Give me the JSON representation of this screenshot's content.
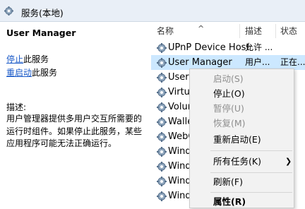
{
  "window": {
    "title": "服务(本地)"
  },
  "left_panel": {
    "service_name": "User Manager",
    "actions": [
      {
        "link": "停止",
        "rest": "此服务"
      },
      {
        "link": "重启动",
        "rest": "此服务"
      }
    ],
    "description_label": "描述:",
    "description": "用户管理器提供多用户交互所需要的运行时组件。如果停止此服务，某些应用程序可能无法正确运行。"
  },
  "list": {
    "columns": {
      "name": "名称",
      "description": "描述",
      "status": "状态"
    },
    "rows": [
      {
        "name": "UPnP Device Host",
        "desc": "允许 ...",
        "status": ""
      },
      {
        "name": "User Manager",
        "desc": "用户...",
        "status": "正在..."
      },
      {
        "name": "User",
        "desc": "",
        "status": ""
      },
      {
        "name": "Virtua",
        "desc": "",
        "status": ""
      },
      {
        "name": "Volun",
        "desc": "",
        "status": ""
      },
      {
        "name": "Walle",
        "desc": "",
        "status": ""
      },
      {
        "name": "WebC",
        "desc": "",
        "status": ""
      },
      {
        "name": "Wind",
        "desc": "",
        "status": ""
      },
      {
        "name": "Wind",
        "desc": "",
        "status": ""
      },
      {
        "name": "Wind",
        "desc": "",
        "status": ""
      },
      {
        "name": "Wind",
        "desc": "",
        "status": ""
      }
    ]
  },
  "context_menu": {
    "start": "启动(S)",
    "stop": "停止(O)",
    "pause": "暂停(U)",
    "resume": "恢复(M)",
    "restart": "重新启动(E)",
    "all_tasks": "所有任务(K)",
    "refresh": "刷新(F)",
    "properties": "属性(R)"
  },
  "colors": {
    "selection": "#cce8ff",
    "link": "#1a5ac8",
    "header_bg": "#e9eff7"
  },
  "icons": {
    "header": "gear-icon",
    "row": "service-gear-icon",
    "submenu": "chevron-right-icon"
  }
}
